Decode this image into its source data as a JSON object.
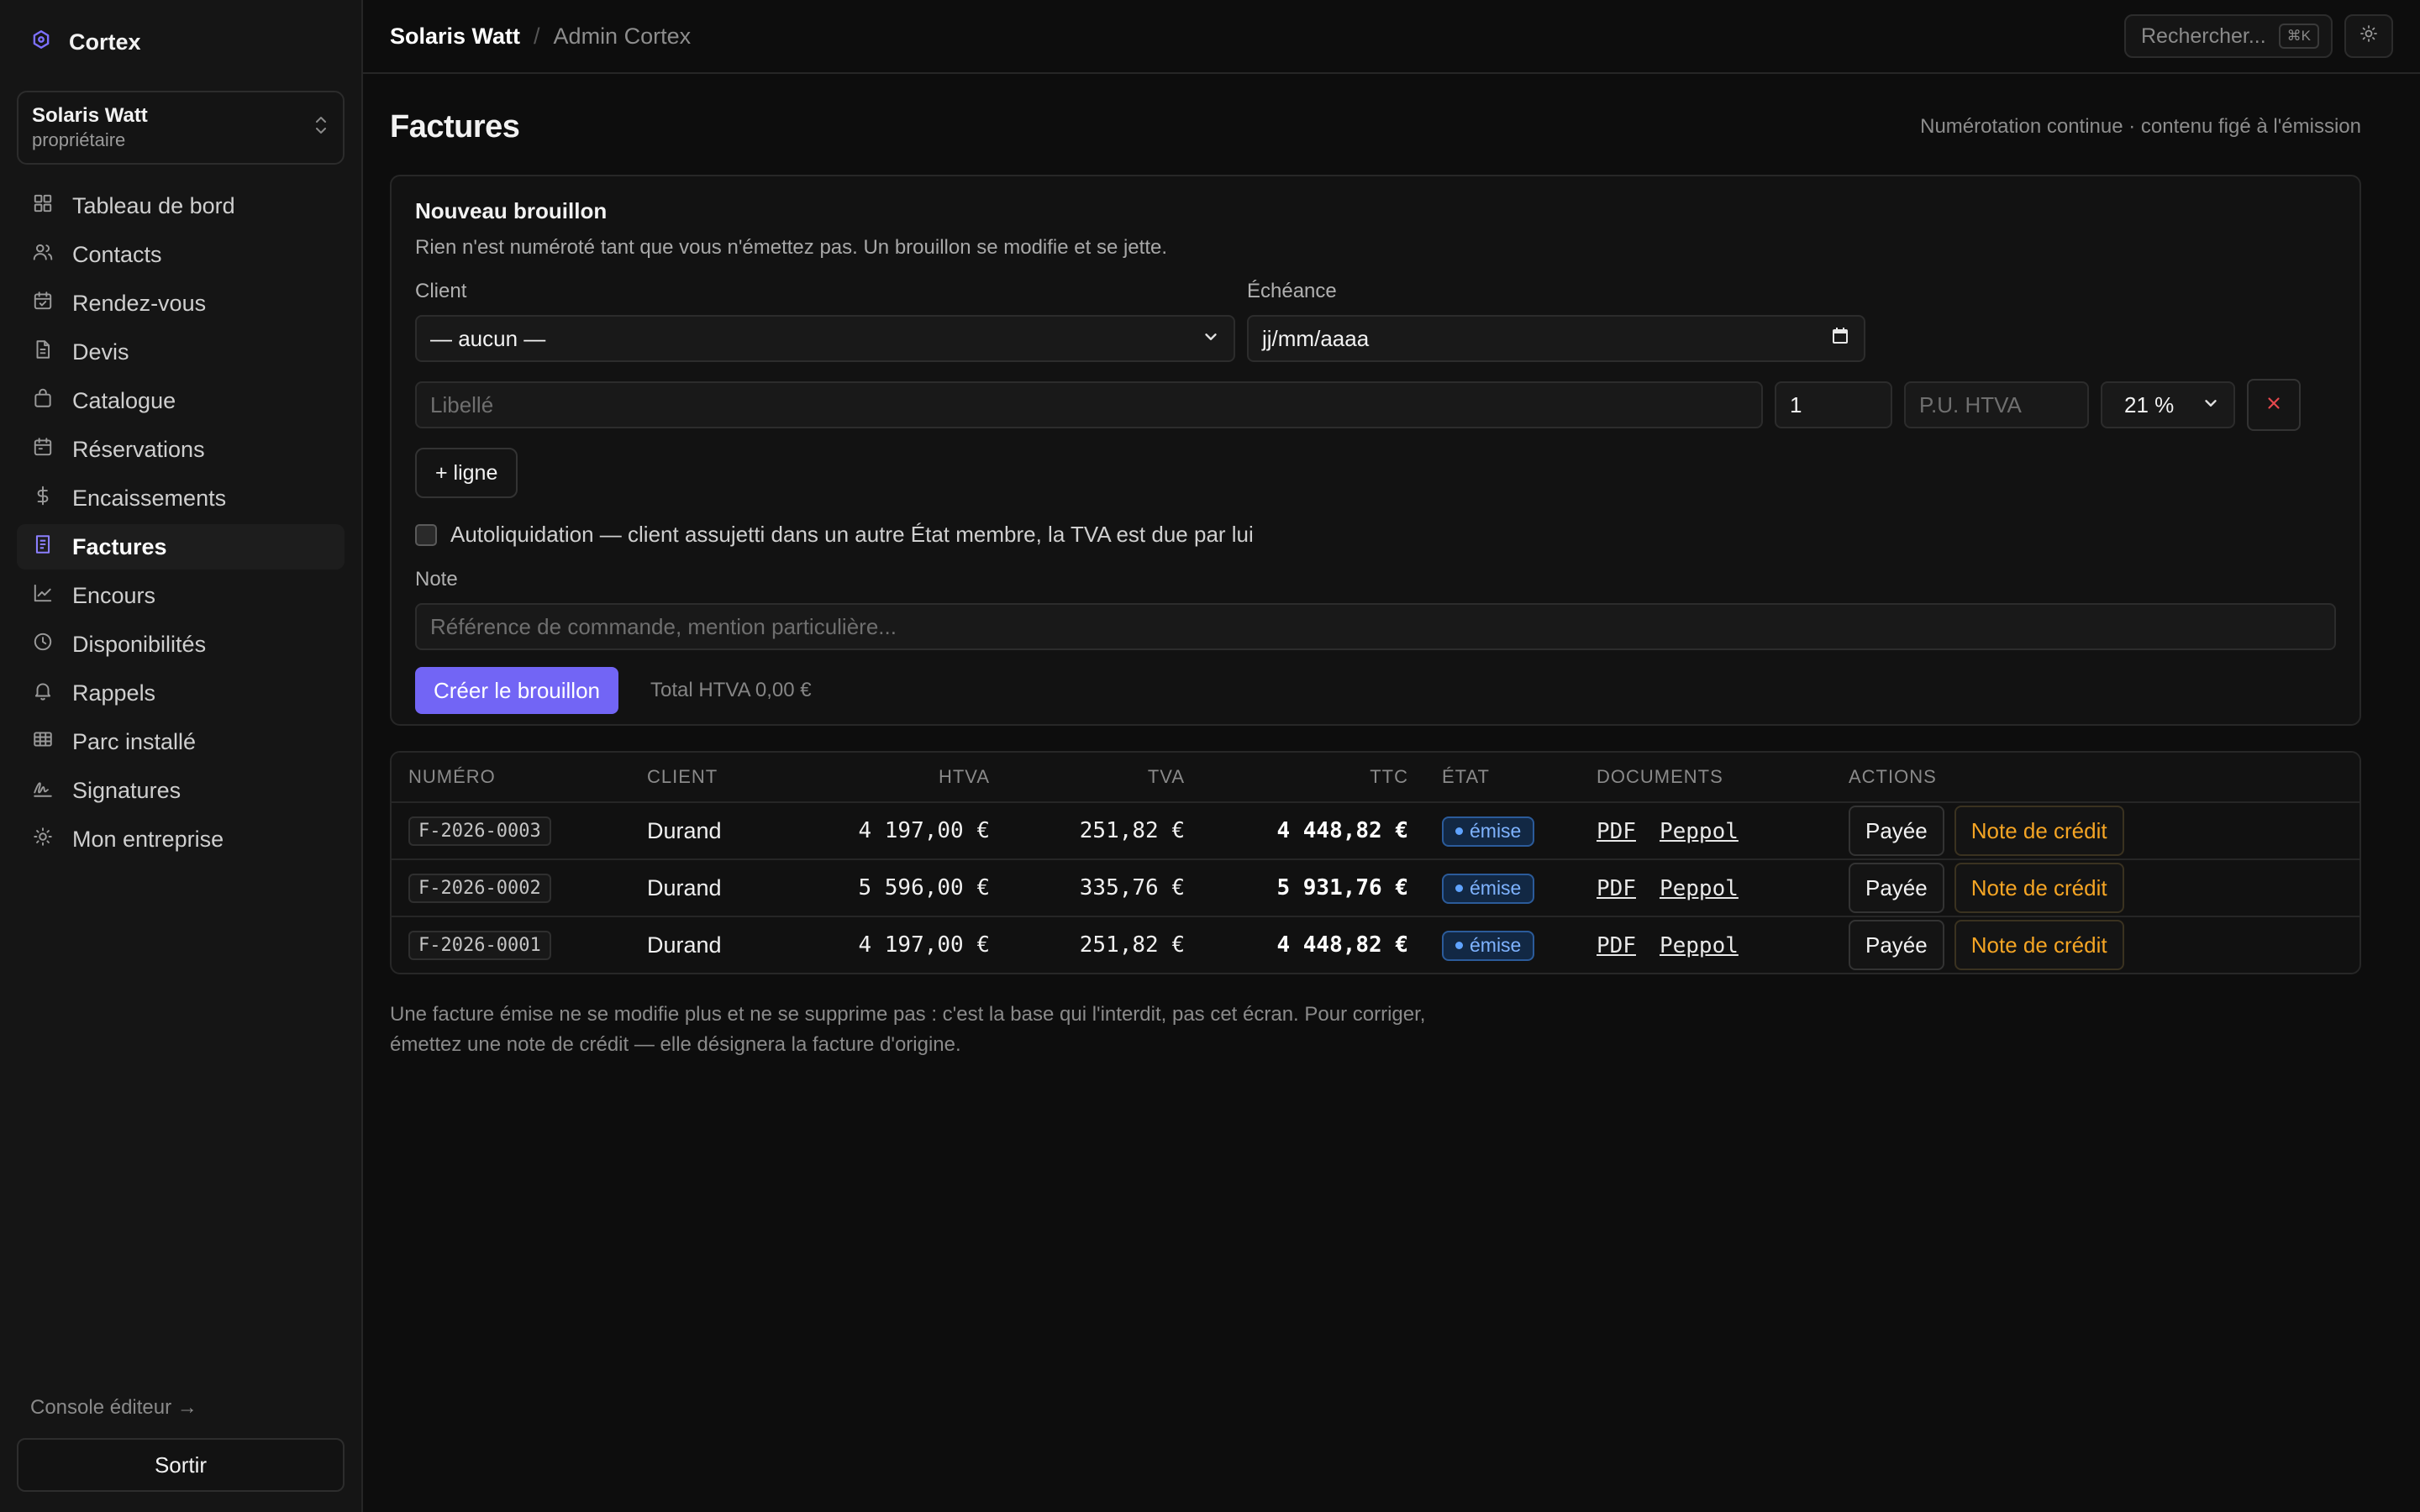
{
  "brand": {
    "name": "Cortex",
    "accent": "#7265f5"
  },
  "org": {
    "name": "Solaris Watt",
    "role": "propriétaire"
  },
  "sidebar": {
    "items": [
      {
        "label": "Tableau de bord",
        "icon": "dashboard-icon"
      },
      {
        "label": "Contacts",
        "icon": "users-icon"
      },
      {
        "label": "Rendez-vous",
        "icon": "calendar-icon"
      },
      {
        "label": "Devis",
        "icon": "document-icon"
      },
      {
        "label": "Catalogue",
        "icon": "bag-icon"
      },
      {
        "label": "Réservations",
        "icon": "calendar-icon"
      },
      {
        "label": "Encaissements",
        "icon": "dollar-icon"
      },
      {
        "label": "Factures",
        "icon": "invoice-icon",
        "active": true
      },
      {
        "label": "Encours",
        "icon": "trend-icon"
      },
      {
        "label": "Disponibilités",
        "icon": "clock-icon"
      },
      {
        "label": "Rappels",
        "icon": "bell-icon"
      },
      {
        "label": "Parc installé",
        "icon": "grid-icon"
      },
      {
        "label": "Signatures",
        "icon": "signature-icon"
      },
      {
        "label": "Mon entreprise",
        "icon": "sun-icon"
      }
    ],
    "console_link": "Console éditeur →",
    "logout": "Sortir"
  },
  "topbar": {
    "breadcrumb_org": "Solaris Watt",
    "breadcrumb_sep": "/",
    "breadcrumb_page": "Admin Cortex",
    "search_label": "Rechercher...",
    "search_kbd": "⌘K"
  },
  "page": {
    "title": "Factures",
    "subtitle": "Numérotation continue · contenu figé à l'émission"
  },
  "draft": {
    "title": "Nouveau brouillon",
    "description": "Rien n'est numéroté tant que vous n'émettez pas. Un brouillon se modifie et se jette.",
    "client_label": "Client",
    "client_value": "— aucun —",
    "due_label": "Échéance",
    "due_placeholder": "jj/mm/aaaa",
    "line": {
      "label_placeholder": "Libellé",
      "qty": "1",
      "price_placeholder": "P.U. HTVA",
      "vat": "21 %"
    },
    "add_line": "+ ligne",
    "reverse_charge": "Autoliquidation — client assujetti dans un autre État membre, la TVA est due par lui",
    "note_label": "Note",
    "note_placeholder": "Référence de commande, mention particulière...",
    "create_button": "Créer le brouillon",
    "total": "Total HTVA 0,00 €"
  },
  "table": {
    "headers": [
      "NUMÉRO",
      "CLIENT",
      "HTVA",
      "TVA",
      "TTC",
      "ÉTAT",
      "DOCUMENTS",
      "ACTIONS"
    ],
    "rows": [
      {
        "number": "F-2026-0003",
        "client": "Durand",
        "htva": "4 197,00 €",
        "tva": "251,82 €",
        "ttc": "4 448,82 €",
        "status": "émise",
        "pdf": "PDF",
        "peppol": "Peppol",
        "paid": "Payée",
        "credit": "Note de crédit"
      },
      {
        "number": "F-2026-0002",
        "client": "Durand",
        "htva": "5 596,00 €",
        "tva": "335,76 €",
        "ttc": "5 931,76 €",
        "status": "émise",
        "pdf": "PDF",
        "peppol": "Peppol",
        "paid": "Payée",
        "credit": "Note de crédit"
      },
      {
        "number": "F-2026-0001",
        "client": "Durand",
        "htva": "4 197,00 €",
        "tva": "251,82 €",
        "ttc": "4 448,82 €",
        "status": "émise",
        "pdf": "PDF",
        "peppol": "Peppol",
        "paid": "Payée",
        "credit": "Note de crédit"
      }
    ]
  },
  "footnote": "Une facture émise ne se modifie plus et ne se supprime pas : c'est la base qui l'interdit, pas cet écran. Pour corriger, émettez une note de crédit — elle désignera la facture d'origine."
}
